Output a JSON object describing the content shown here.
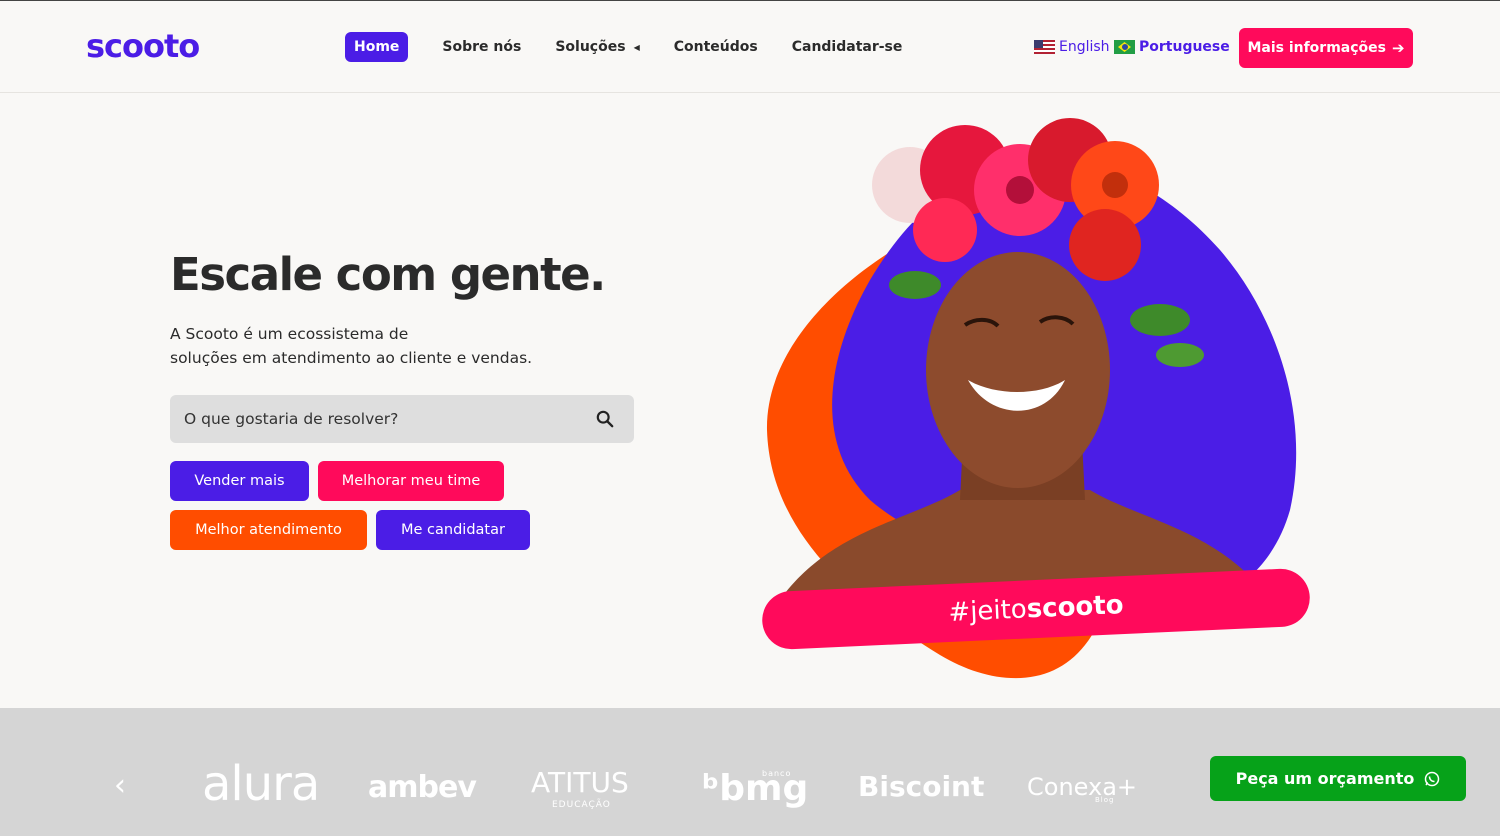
{
  "header": {
    "logo": "scooto",
    "nav": [
      {
        "label": "Home",
        "active": true
      },
      {
        "label": "Sobre nós"
      },
      {
        "label": "Soluções",
        "has_dropdown": true
      },
      {
        "label": "Conteúdos"
      },
      {
        "label": "Candidatar-se"
      }
    ],
    "languages": [
      {
        "label": "English",
        "flag": "us-flag-icon"
      },
      {
        "label": "Portuguese",
        "flag": "br-flag-icon"
      }
    ],
    "cta_label": "Mais informações"
  },
  "hero": {
    "title_regular": "Escale com ",
    "title_bold": "gente.",
    "subtitle_line1": "A Scooto é um ecossistema de",
    "subtitle_line2": "soluções em atendimento ao cliente e vendas.",
    "search_placeholder": "O que gostaria de resolver?",
    "buttons": [
      {
        "label": "Vender mais",
        "color": "#4b1de6"
      },
      {
        "label": "Melhorar meu time",
        "color": "#ff0a5b"
      },
      {
        "label": "Melhor atendimento",
        "color": "#ff4d00"
      },
      {
        "label": "Me candidatar",
        "color": "#4b1de6"
      }
    ],
    "hashtag_regular": "#jeito",
    "hashtag_bold": "scooto"
  },
  "clients": {
    "logos": [
      {
        "name": "alura"
      },
      {
        "name": "ambev"
      },
      {
        "name": "ATITUS",
        "sub": "EDUCAÇÃO"
      },
      {
        "name": "bmg",
        "sub": "banco"
      },
      {
        "name": "Biscoint"
      },
      {
        "name": "Conexa",
        "sub": "Blog"
      }
    ]
  },
  "whatsapp": {
    "label": "Peça um orçamento",
    "icon": "whatsapp-icon"
  },
  "colors": {
    "brand_purple": "#4b1de6",
    "brand_pink": "#ff0a5b",
    "brand_orange": "#ff4d00",
    "whatsapp_green": "#06a219"
  }
}
